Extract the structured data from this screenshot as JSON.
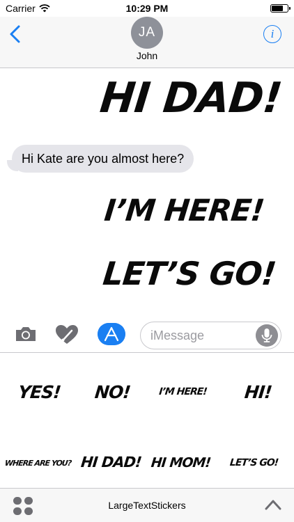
{
  "status_bar": {
    "carrier": "Carrier",
    "time": "10:29 PM"
  },
  "header": {
    "avatar_initials": "JA",
    "contact_name": "John",
    "info_glyph": "i"
  },
  "conversation": {
    "sticker_top": "HI DAD!",
    "received_message": "Hi Kate are you almost here?",
    "sticker_middle": "I’M HERE!",
    "sticker_bottom": "LET’S GO!"
  },
  "input_bar": {
    "placeholder": "iMessage"
  },
  "sticker_drawer": {
    "row1": [
      "YES!",
      "NO!",
      "I’M HERE!",
      "HI!"
    ],
    "row2": [
      "WHERE ARE YOU?",
      "HI DAD!",
      "HI MOM!",
      "LET’S GO!"
    ]
  },
  "bottom_bar": {
    "app_name": "LargeTextStickers"
  },
  "icons": {
    "back": "chevron-left-icon",
    "info": "info-icon",
    "camera": "camera-icon",
    "digital_touch": "heart-icon",
    "app_store": "app-store-icon",
    "mic": "microphone-icon",
    "app_drawer": "grid-icon",
    "expand": "chevron-up-icon",
    "wifi": "wifi-icon",
    "battery": "battery-icon"
  },
  "colors": {
    "accent": "#1a7ff2",
    "bubble_received": "#e5e5ea",
    "bar_background": "#f7f7f7"
  }
}
